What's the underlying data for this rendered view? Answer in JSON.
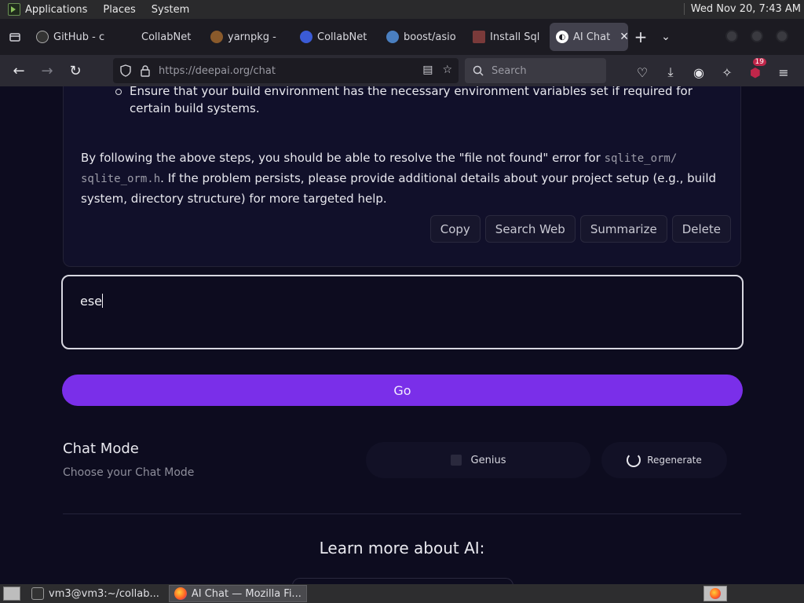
{
  "top_panel": {
    "menus": [
      "Applications",
      "Places",
      "System"
    ],
    "clock": "Wed Nov 20,  7:43 AM"
  },
  "tabs": [
    {
      "label": "GitHub - c",
      "icon": "github-icon",
      "active": false
    },
    {
      "label": "CollabNet",
      "icon": "collabnet-icon",
      "active": false
    },
    {
      "label": "yarnpkg -",
      "icon": "yarnpkg-icon",
      "active": false
    },
    {
      "label": "CollabNet",
      "icon": "collabnet-search-icon",
      "active": false
    },
    {
      "label": "boost/asio",
      "icon": "boost-icon",
      "active": false
    },
    {
      "label": "Install Sql",
      "icon": "install-icon",
      "active": false
    },
    {
      "label": "AI Chat",
      "icon": "deepai-icon",
      "active": true
    }
  ],
  "navbar": {
    "url": "https://deepai.org/chat",
    "search_placeholder": "Search",
    "extension_badge": "19"
  },
  "message": {
    "bullet": "Ensure that your build environment has the necessary environment variables set if required for certain build systems.",
    "para_before": "By following the above steps, you should be able to resolve the \"file not found\" error for ",
    "code1": "sqlite_orm/",
    "code2": "sqlite_orm.h",
    "para_after": ". If the problem persists, please provide additional details about your project setup (e.g., build system, directory structure) for more targeted help.",
    "actions": [
      "Copy",
      "Search Web",
      "Summarize",
      "Delete"
    ]
  },
  "input": {
    "value": "ese"
  },
  "go_label": "Go",
  "chat_mode": {
    "title": "Chat Mode",
    "subtitle": "Choose your Chat Mode",
    "genius_label": "Genius",
    "regenerate_label": "Regenerate"
  },
  "learn_more": "Learn more about AI:",
  "taskbar": {
    "items": [
      "vm3@vm3:~/collab...",
      "AI Chat — Mozilla Fi..."
    ]
  }
}
